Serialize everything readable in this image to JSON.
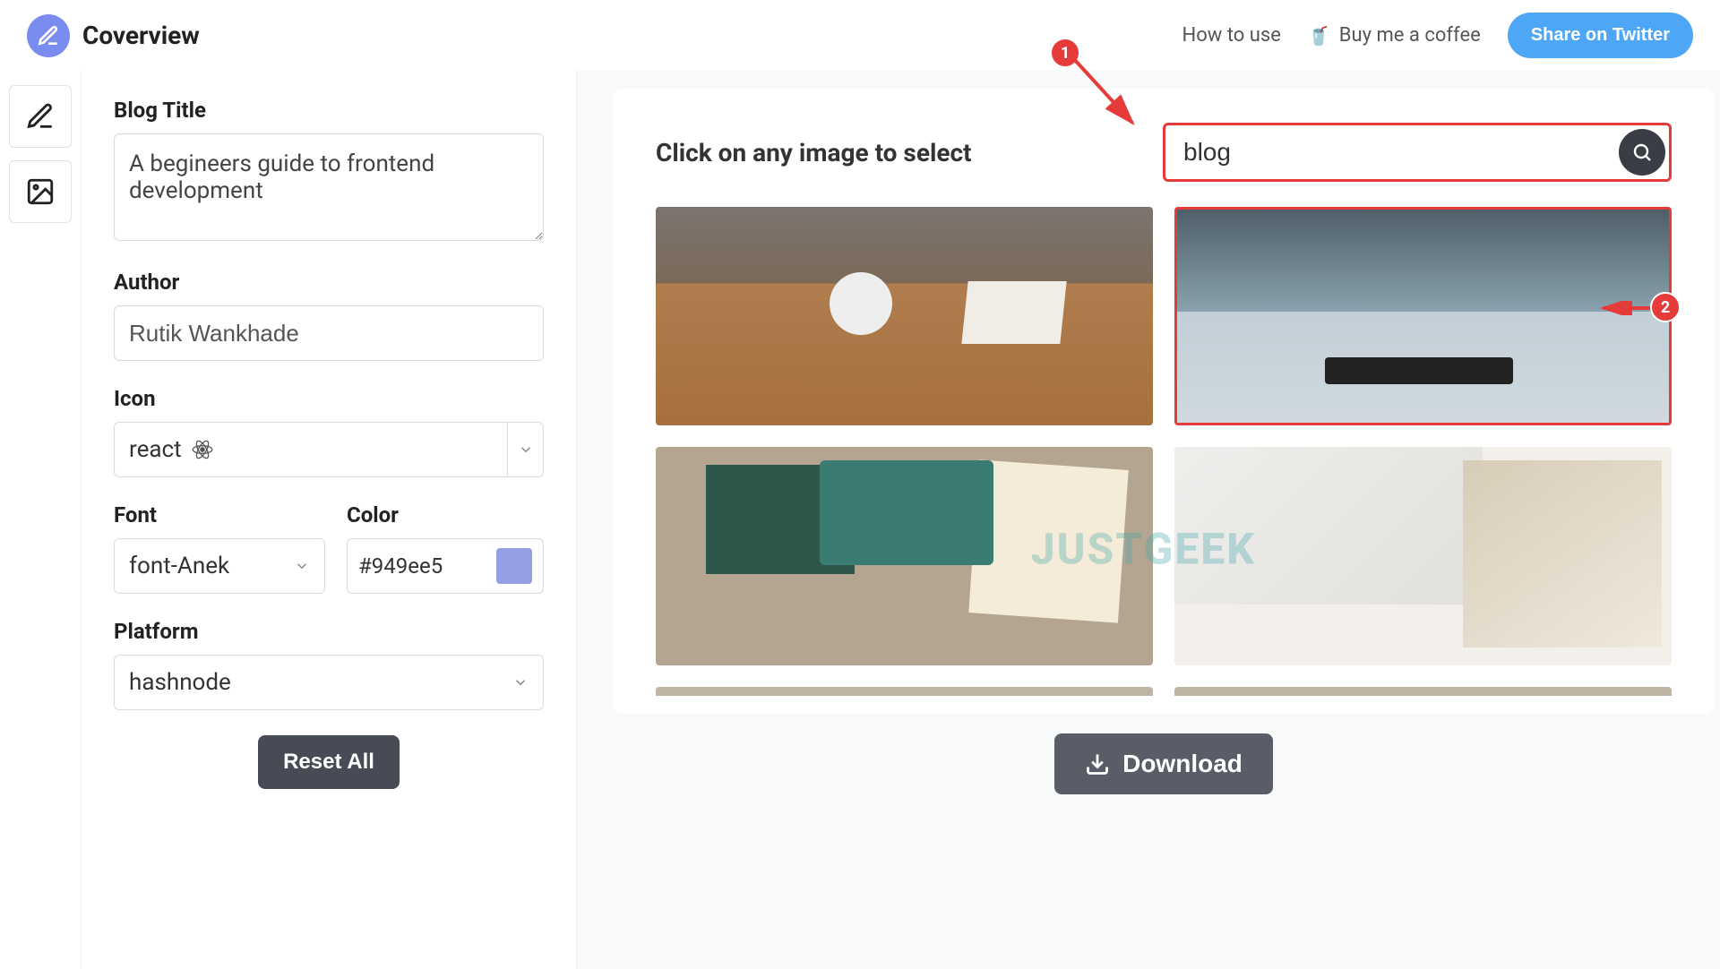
{
  "header": {
    "app_name": "Coverview",
    "how_to_use": "How to use",
    "buy_coffee": "Buy me a coffee",
    "share_twitter": "Share on Twitter"
  },
  "sidebar": {
    "blog_title_label": "Blog Title",
    "blog_title_value": "A begineers guide to frontend development",
    "author_label": "Author",
    "author_value": "Rutik Wankhade",
    "icon_label": "Icon",
    "icon_value": "react",
    "font_label": "Font",
    "font_value": "font-Anek",
    "color_label": "Color",
    "color_value": "#949ee5",
    "platform_label": "Platform",
    "platform_value": "hashnode",
    "reset_label": "Reset All"
  },
  "main": {
    "picker_title": "Click on any image to select",
    "search_value": "blog",
    "download_label": "Download",
    "watermark": "JUSTGEEK"
  },
  "annotations": {
    "badge1": "1",
    "badge2": "2"
  }
}
